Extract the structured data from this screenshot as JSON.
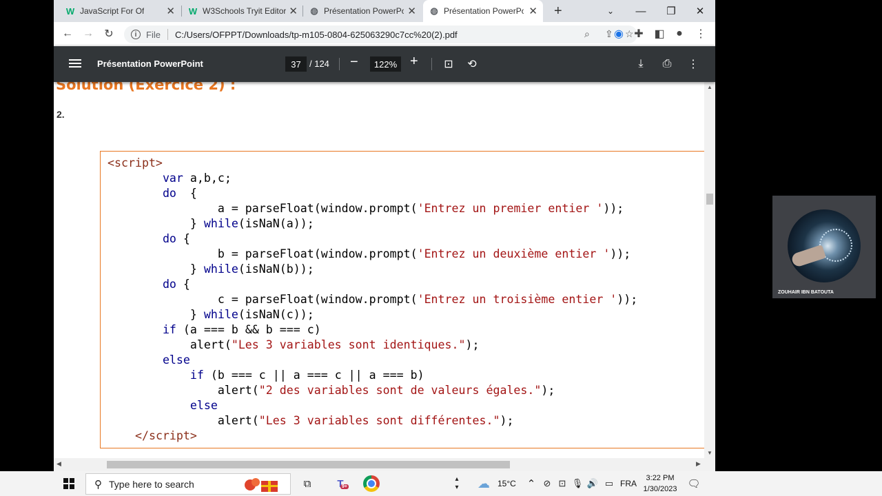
{
  "browser": {
    "tabs": [
      {
        "title": "JavaScript For Of",
        "favicon": "w3schools-icon",
        "active": false
      },
      {
        "title": "W3Schools Tryit Editor",
        "favicon": "w3schools-icon",
        "active": false
      },
      {
        "title": "Présentation PowerPoi",
        "favicon": "globe-icon",
        "active": false
      },
      {
        "title": "Présentation PowerPoi",
        "favicon": "globe-icon",
        "active": true
      }
    ],
    "new_tab": "+",
    "address": {
      "scheme": "File",
      "url": "C:/Users/OFPPT/Downloads/tp-m105-0804-625063290c7cc%20(2).pdf"
    }
  },
  "pdf_viewer": {
    "title": "Présentation PowerPoint",
    "current_page": "37",
    "total_pages": "/ 124",
    "zoom": "122%"
  },
  "slide": {
    "heading": "Solution (Exercice 2) :",
    "item_number": "2."
  },
  "webcam": {
    "name": "ZOUHAIR IBN BATOUTA"
  },
  "taskbar": {
    "search_placeholder": "Type here to search",
    "weather": "15°C",
    "language": "FRA",
    "time": "3:22 PM",
    "date": "1/30/2023",
    "teams_badge": "9+"
  },
  "colors": {
    "accent_orange": "#e87722",
    "pdf_toolbar": "#323639",
    "tabstrip": "#dee1e6",
    "keyword_blue": "#00008b",
    "string_red": "#a31515"
  }
}
